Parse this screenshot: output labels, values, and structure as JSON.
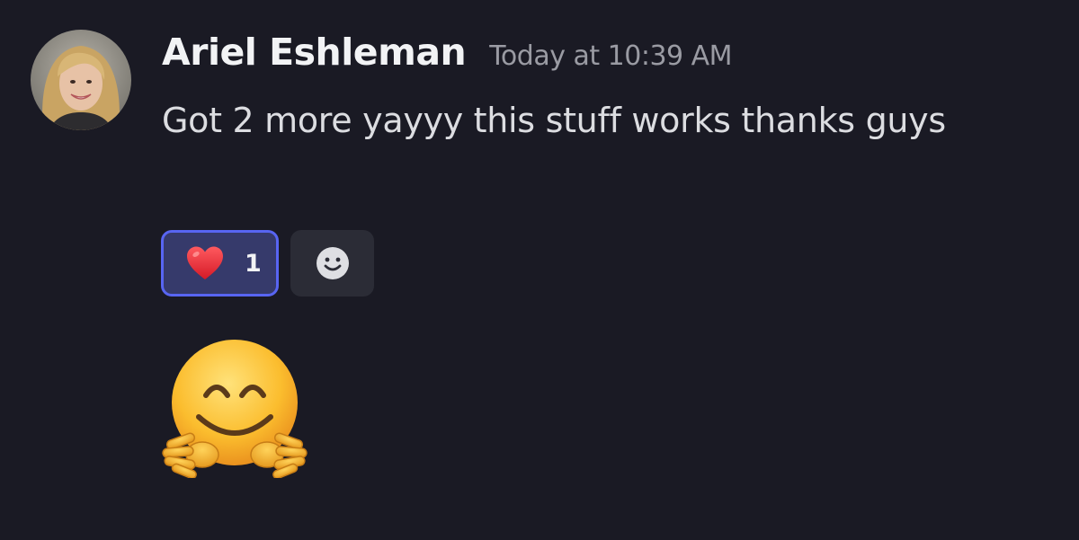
{
  "message": {
    "author": "Ariel Eshleman",
    "timestamp": "Today at 10:39 AM",
    "text": "Got 2 more yayyy this stuff works thanks guys"
  },
  "reactions": [
    {
      "emoji": "heart-emoji",
      "count": "1",
      "active": true
    },
    {
      "emoji": "add-reaction-smiley-icon"
    }
  ],
  "attachment_emoji": "hugging-face-emoji",
  "colors": {
    "background": "#1a1a24",
    "reaction_active_bg": "#363a6b",
    "reaction_active_border": "#5865f2",
    "reaction_add_bg": "#2b2c36"
  }
}
